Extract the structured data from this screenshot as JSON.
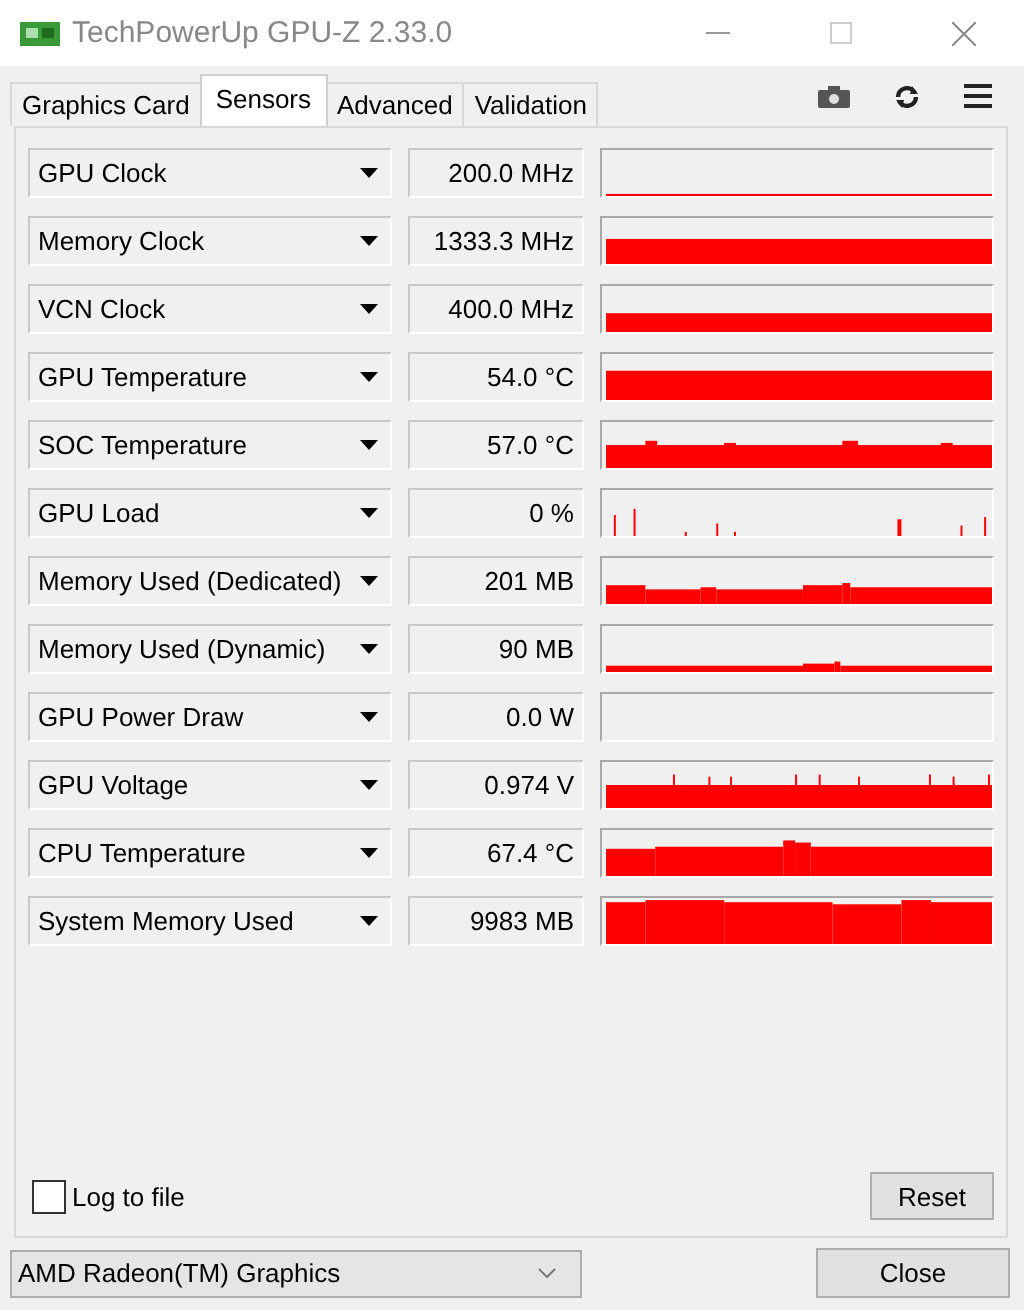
{
  "window": {
    "title": "TechPowerUp GPU-Z 2.33.0"
  },
  "tabs": [
    {
      "label": "Graphics Card",
      "selected": false
    },
    {
      "label": "Sensors",
      "selected": true
    },
    {
      "label": "Advanced",
      "selected": false
    },
    {
      "label": "Validation",
      "selected": false
    }
  ],
  "sensors": [
    {
      "name": "GPU Clock",
      "reading": "200.0 MHz"
    },
    {
      "name": "Memory Clock",
      "reading": "1333.3 MHz"
    },
    {
      "name": "VCN Clock",
      "reading": "400.0 MHz"
    },
    {
      "name": "GPU Temperature",
      "reading": "54.0 °C"
    },
    {
      "name": "SOC Temperature",
      "reading": "57.0 °C"
    },
    {
      "name": "GPU Load",
      "reading": "0 %"
    },
    {
      "name": "Memory Used (Dedicated)",
      "reading": "201 MB"
    },
    {
      "name": "Memory Used (Dynamic)",
      "reading": "90 MB"
    },
    {
      "name": "GPU Power Draw",
      "reading": "0.0 W"
    },
    {
      "name": "GPU Voltage",
      "reading": "0.974 V"
    },
    {
      "name": "CPU Temperature",
      "reading": "67.4 °C"
    },
    {
      "name": "System Memory Used",
      "reading": "9983 MB"
    }
  ],
  "log_to_file": {
    "label": "Log to file",
    "checked": false
  },
  "reset_button": "Reset",
  "device_select": {
    "value": "AMD Radeon(TM) Graphics"
  },
  "close_button": "Close"
}
